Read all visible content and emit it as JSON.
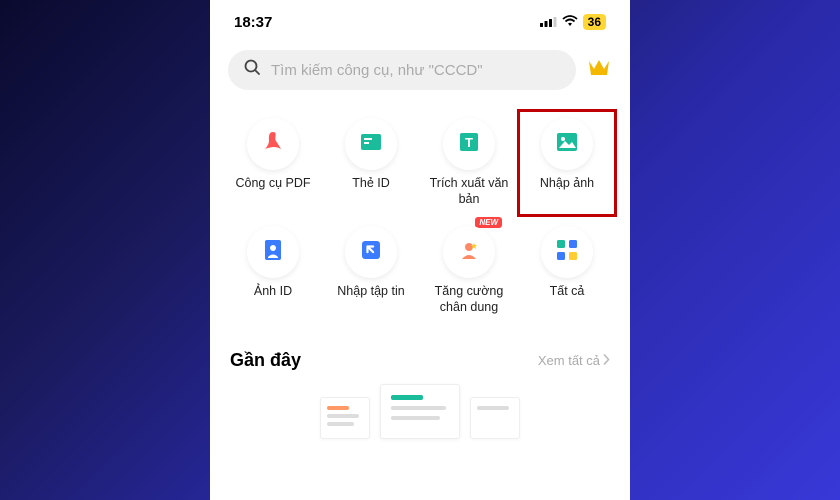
{
  "status": {
    "time": "18:37",
    "battery": "36"
  },
  "search": {
    "placeholder": "Tìm kiếm công cụ, như \"CCCD\""
  },
  "tools": {
    "row1": [
      {
        "label": "Công cụ PDF"
      },
      {
        "label": "Thẻ ID"
      },
      {
        "label": "Trích xuất văn bản"
      },
      {
        "label": "Nhập ảnh"
      }
    ],
    "row2": [
      {
        "label": "Ảnh ID"
      },
      {
        "label": "Nhập tập tin"
      },
      {
        "label": "Tăng cường chân dung",
        "badge": "NEW"
      },
      {
        "label": "Tất cả"
      }
    ]
  },
  "recent": {
    "title": "Gần đây",
    "see_all": "Xem tất cả"
  }
}
